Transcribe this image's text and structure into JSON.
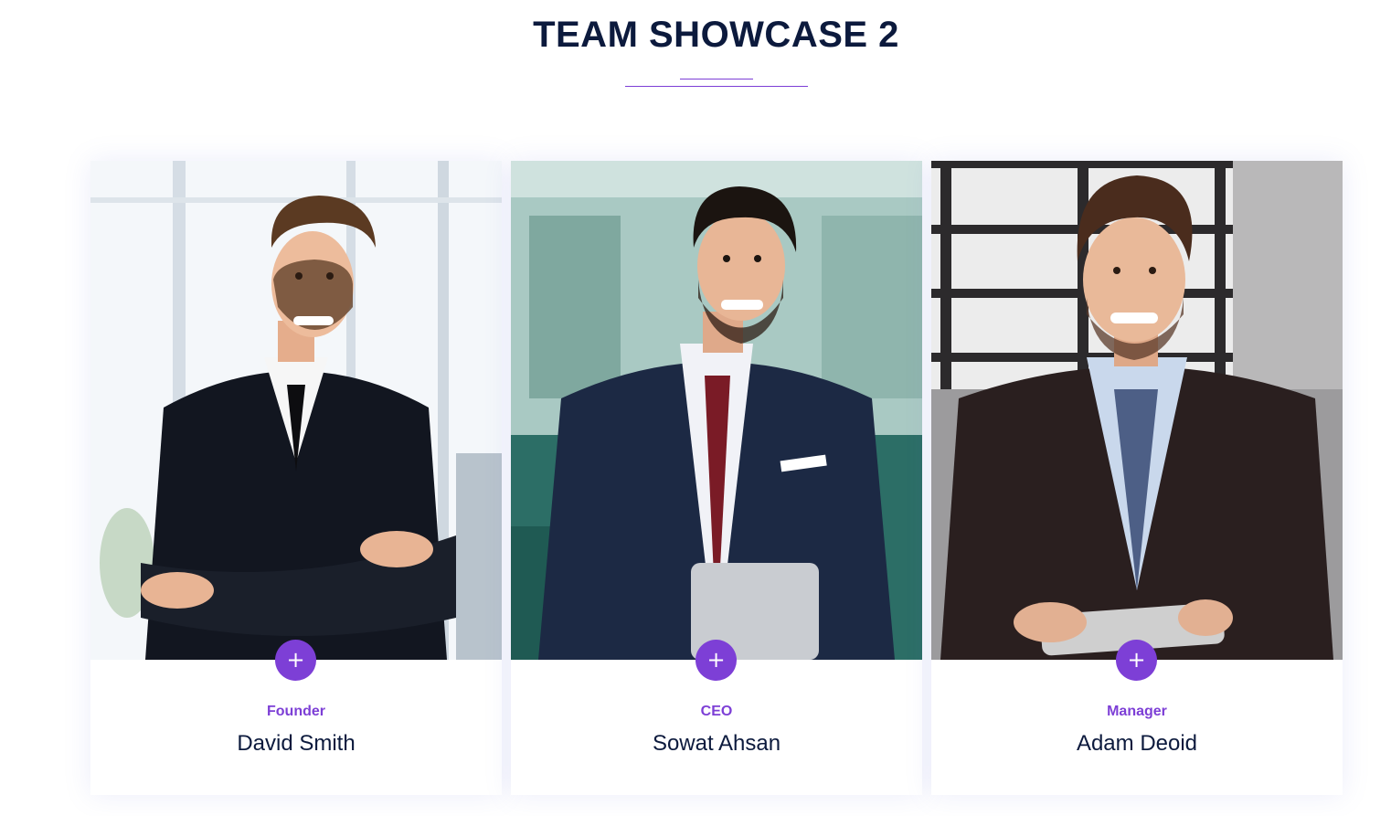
{
  "section": {
    "title": "TEAM SHOWCASE 2"
  },
  "accent_color": "#7d3fd6",
  "heading_color": "#0c1a3d",
  "plus_icon": "+",
  "members": [
    {
      "role": "Founder",
      "name": "David Smith"
    },
    {
      "role": "CEO",
      "name": "Sowat Ahsan"
    },
    {
      "role": "Manager",
      "name": "Adam Deoid"
    }
  ]
}
